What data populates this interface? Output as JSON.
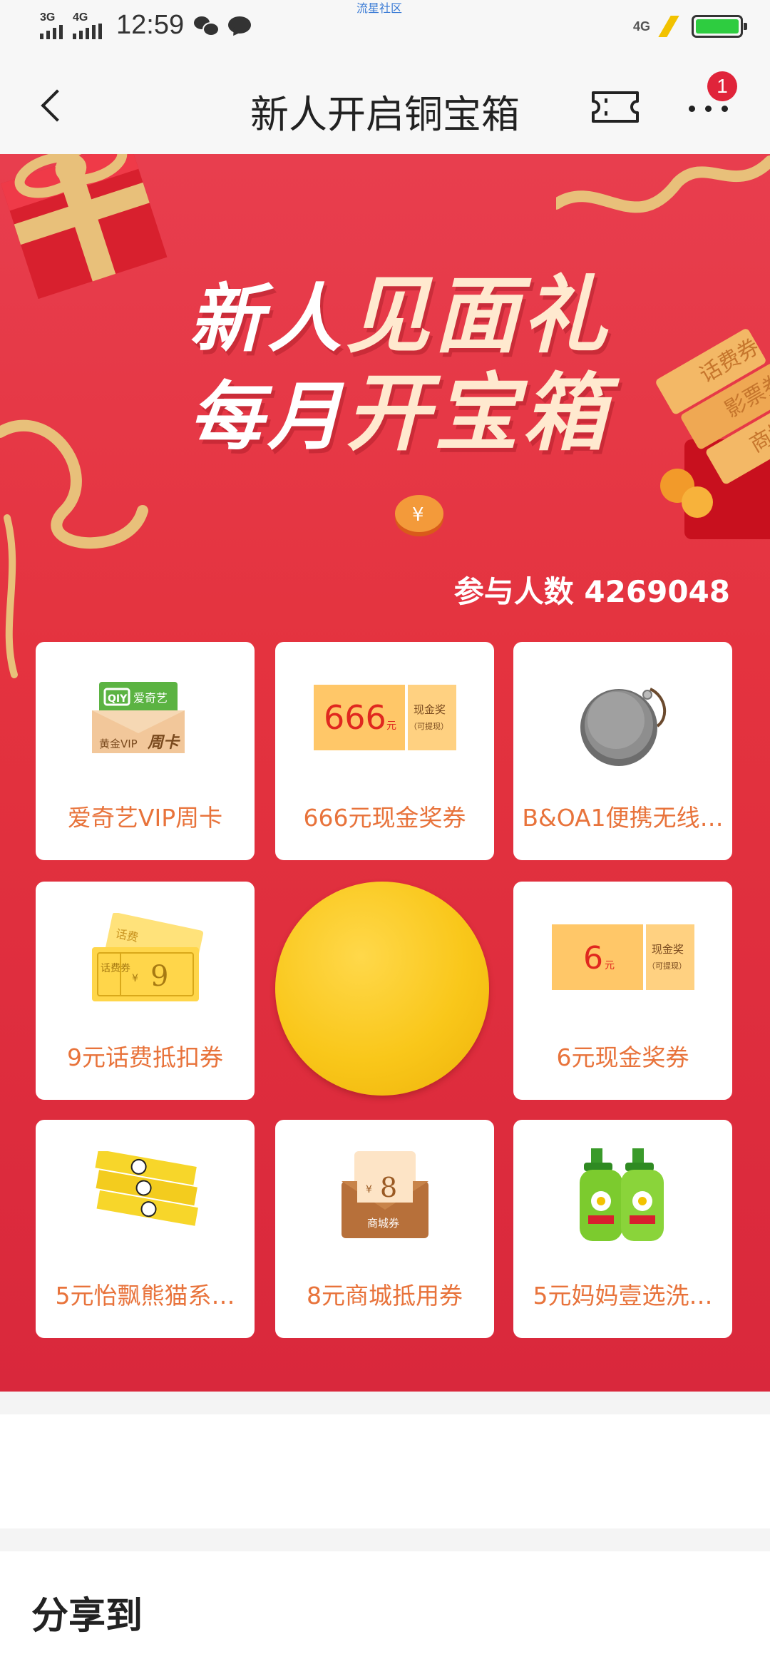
{
  "status_bar": {
    "signal1": "3G",
    "signal2": "4G",
    "time": "12:59",
    "center_text": "流星社区",
    "network_right": "4G",
    "battery_level": 1.0
  },
  "nav": {
    "title": "新人开启铜宝箱",
    "badge_count": "1"
  },
  "hero": {
    "headline_line1_a": "新人",
    "headline_line1_b": "见面礼",
    "headline_line2_a": "每月",
    "headline_line2_b": "开宝箱",
    "participants": "参与人数 4269048"
  },
  "prizes": [
    {
      "label": "爱奇艺VIP周卡",
      "art": {
        "brand": "爱奇艺",
        "tag": "黄金VIP",
        "big": "周卡"
      }
    },
    {
      "label": "666元现金奖券",
      "art": {
        "amount": "666",
        "unit": "元",
        "side1": "现金奖",
        "side2": "（可提现）"
      }
    },
    {
      "label": "B&OA1便携无线…",
      "art": {}
    },
    {
      "label": "9元话费抵扣券",
      "art": {
        "top": "话费",
        "left": "话费券",
        "amount": "9"
      }
    },
    {
      "label": "6元现金奖券",
      "art": {
        "amount": "6",
        "unit": "元",
        "side1": "现金奖",
        "side2": "（可提现）"
      }
    },
    {
      "label": "5元怡飘熊猫系…",
      "art": {}
    },
    {
      "label": "8元商城抵用券",
      "art": {
        "amount": "8",
        "tag": "商城券"
      }
    },
    {
      "label": "5元妈妈壹选洗…",
      "art": {}
    }
  ],
  "envelope_tags": [
    "话费券",
    "影票券",
    "商城券"
  ],
  "share": {
    "title": "分享到"
  },
  "colors": {
    "hero_red": "#e4333f",
    "card_text": "#e8733b",
    "coin_gold": "#f9c71a",
    "badge_red": "#e0243a"
  }
}
